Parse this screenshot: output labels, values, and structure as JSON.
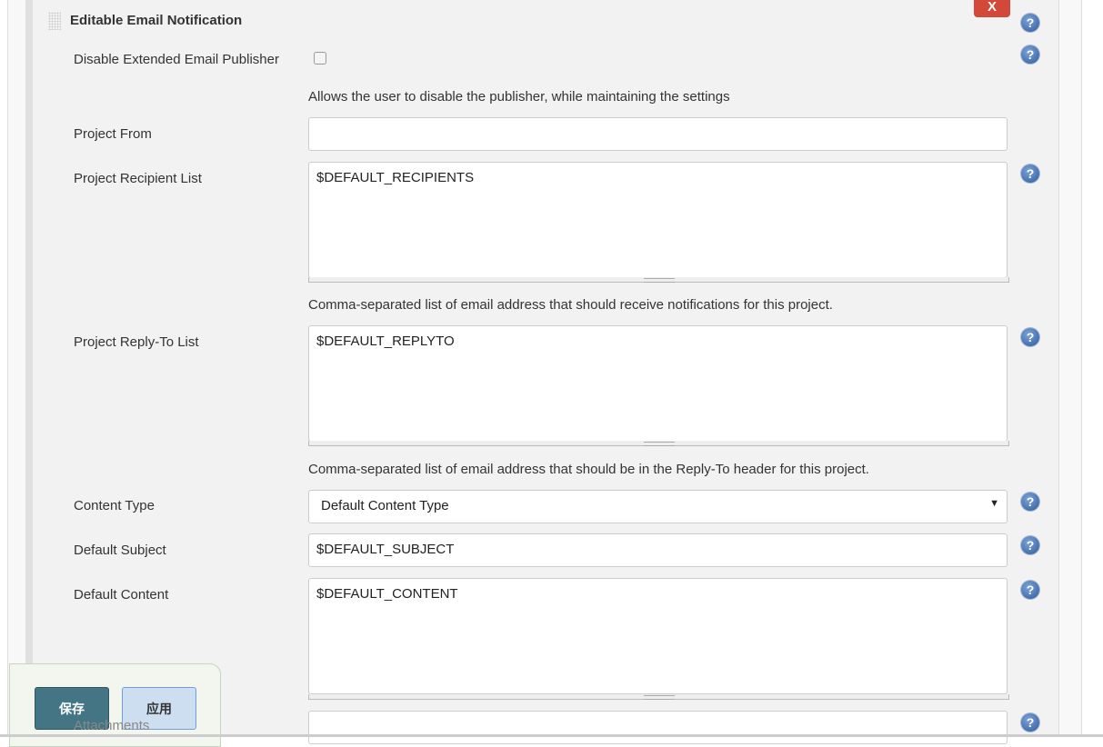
{
  "section": {
    "title": "Editable Email Notification",
    "close_label": "X"
  },
  "fields": {
    "disable": {
      "label": "Disable Extended Email Publisher",
      "checked": false,
      "description": "Allows the user to disable the publisher, while maintaining the settings"
    },
    "project_from": {
      "label": "Project From",
      "value": ""
    },
    "recipient_list": {
      "label": "Project Recipient List",
      "value": "$DEFAULT_RECIPIENTS",
      "description": "Comma-separated list of email address that should receive notifications for this project."
    },
    "reply_to": {
      "label": "Project Reply-To List",
      "value": "$DEFAULT_REPLYTO",
      "description": "Comma-separated list of email address that should be in the Reply-To header for this project."
    },
    "content_type": {
      "label": "Content Type",
      "value": "Default Content Type"
    },
    "subject": {
      "label": "Default Subject",
      "value": "$DEFAULT_SUBJECT"
    },
    "content": {
      "label": "Default Content",
      "value": "$DEFAULT_CONTENT"
    },
    "attachments": {
      "label": "Attachments",
      "value": ""
    }
  },
  "help_icon": "question-circle-icon",
  "buttons": {
    "save": "保存",
    "apply": "应用"
  }
}
